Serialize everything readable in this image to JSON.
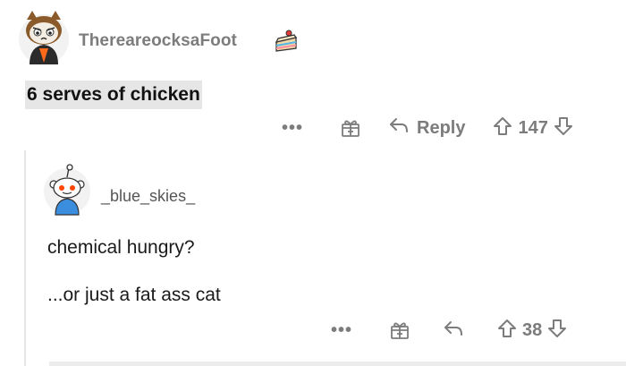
{
  "comments": [
    {
      "username": "ThereareocksaFoot",
      "body": "6 serves of chicken",
      "actions": {
        "more_label": "•••",
        "reply_label": "Reply",
        "vote_count": "147"
      }
    },
    {
      "username": "_blue_skies_",
      "body_lines": [
        "chemical hungry?",
        "...or just a fat ass cat"
      ],
      "actions": {
        "more_label": "•••",
        "vote_count": "38"
      }
    }
  ],
  "icons": {
    "cake": "cake-day-icon",
    "award": "award-gift-icon",
    "reply": "reply-arrow-icon",
    "upvote": "upvote-arrow-icon",
    "downvote": "downvote-arrow-icon"
  },
  "colors": {
    "meta_gray": "#7c7c7c",
    "highlight_bg": "#e6e6e6",
    "thread_line": "#e5e5e5",
    "snoo_orange": "#ff4500",
    "snoo_shirt": "#3b8dde"
  }
}
